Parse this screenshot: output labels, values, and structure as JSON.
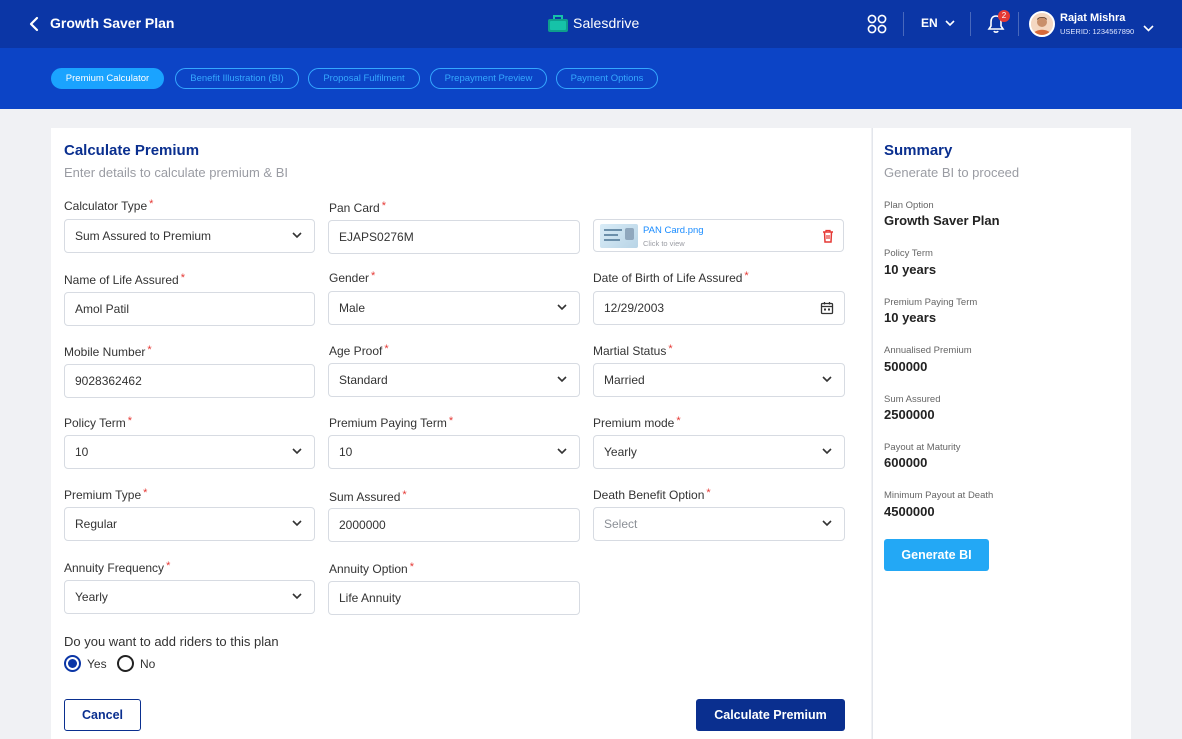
{
  "header": {
    "title": "Growth Saver Plan",
    "brand": "Salesdrive",
    "language": "EN",
    "notification_count": "2",
    "user_name": "Rajat Mishra",
    "user_id": "USERID: 1234567890"
  },
  "tabs": [
    {
      "label": "Premium Calculator",
      "active": true
    },
    {
      "label": "Benefit Illustration (BI)",
      "active": false
    },
    {
      "label": "Proposal Fulfilment",
      "active": false
    },
    {
      "label": "Prepayment Preview",
      "active": false
    },
    {
      "label": "Payment Options",
      "active": false
    }
  ],
  "form": {
    "title": "Calculate Premium",
    "subtitle": "Enter details to calculate premium & BI",
    "fields": {
      "calculator_type": {
        "label": "Calculator Type",
        "value": "Sum Assured to Premium"
      },
      "pan_card": {
        "label": "Pan Card",
        "value": "EJAPS0276M"
      },
      "pan_file": {
        "name": "PAN Card.png",
        "hint": "Click to view"
      },
      "name": {
        "label": "Name of Life Assured",
        "value": "Amol Patil"
      },
      "gender": {
        "label": "Gender",
        "value": "Male"
      },
      "dob": {
        "label": "Date of Birth of Life Assured",
        "value": "12/29/2003"
      },
      "mobile": {
        "label": "Mobile Number",
        "value": "9028362462"
      },
      "age_proof": {
        "label": "Age Proof",
        "value": "Standard"
      },
      "marital_status": {
        "label": "Martial Status",
        "value": "Married"
      },
      "policy_term": {
        "label": "Policy Term",
        "value": "10"
      },
      "premium_paying_term": {
        "label": "Premium Paying Term",
        "value": "10"
      },
      "premium_mode": {
        "label": "Premium mode",
        "value": "Yearly"
      },
      "premium_type": {
        "label": "Premium Type",
        "value": "Regular"
      },
      "sum_assured": {
        "label": "Sum Assured",
        "value": "2000000"
      },
      "death_benefit": {
        "label": "Death Benefit Option",
        "placeholder": "Select"
      },
      "annuity_frequency": {
        "label": "Annuity Frequency",
        "value": "Yearly"
      },
      "annuity_option": {
        "label": "Annuity Option",
        "value": "Life Annuity"
      }
    },
    "riders_question": "Do you want to add riders to this plan",
    "riders_yes": "Yes",
    "riders_no": "No",
    "riders_selected": "Yes",
    "required_mark": "*",
    "cancel_label": "Cancel",
    "calculate_label": "Calculate Premium"
  },
  "summary": {
    "title": "Summary",
    "subtitle": "Generate BI to proceed",
    "items": [
      {
        "label": "Plan Option",
        "value": "Growth Saver Plan"
      },
      {
        "label": "Policy Term",
        "value": "10 years"
      },
      {
        "label": "Premium Paying Term",
        "value": "10 years"
      },
      {
        "label": "Annualised Premium",
        "value": "500000"
      },
      {
        "label": "Sum Assured",
        "value": "2500000"
      },
      {
        "label": "Payout at Maturity",
        "value": "600000"
      },
      {
        "label": "Minimum Payout at Death",
        "value": "4500000"
      }
    ],
    "button_label": "Generate BI"
  },
  "colors": {
    "header_bg": "#0b36a6",
    "stepbar_bg": "#0c44c6",
    "primary": "#0a2f8f",
    "accent": "#23a8f5",
    "required": "#e53935"
  }
}
